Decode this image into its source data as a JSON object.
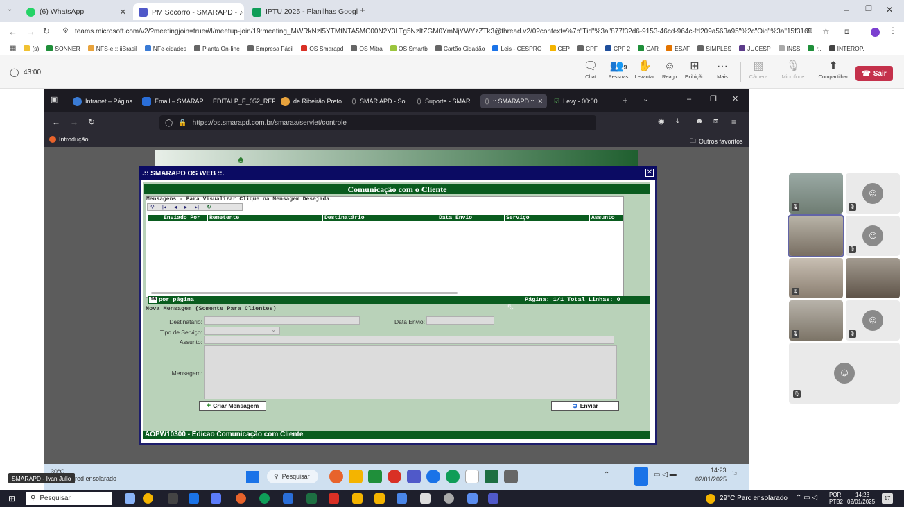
{
  "outer_tabs": [
    {
      "label": "(6) WhatsApp",
      "color": "#25d366"
    },
    {
      "label": "PM Socorro - SMARAPD - ♪ 🔊",
      "color": "#5059c9"
    },
    {
      "label": "IPTU 2025 - Planilhas Google",
      "color": "#0f9d58"
    }
  ],
  "url": "teams.microsoft.com/v2/?meetingjoin=true#/l/meetup-join/19:meeting_MWRkNzI5YTMtNTA5MC00N2Y3LTg5NzItZGM0YmNjYWYzZTk3@thread.v2/0?context=%7b\"Tid\"%3a\"877f32d6-9153-46cd-964c-fd209a563a95\"%2c\"Oid\"%3a\"15f3165b-31b3-4...",
  "bookmarks": [
    "(s)",
    "SONNER",
    "NFS-e :: iiBrasil",
    "NFe-cidades",
    "Planta On-line",
    "Empresa Fácil",
    "OS Smarapd",
    "OS Mitra",
    "OS Smartb",
    "Cartão Cidadão",
    "Leis - CESPRO",
    "CEP",
    "CPF",
    "CPF 2",
    "CAR",
    "ESAF",
    "SIMPLES",
    "JUCESP",
    "INSS",
    "r..",
    "INTEROP."
  ],
  "teams": {
    "timer": "43:00",
    "buttons": [
      "Chat",
      "Pessoas",
      "Levantar",
      "Reagir",
      "Exibição",
      "Mais",
      "Câmera",
      "Microfone",
      "Compartilhar"
    ],
    "people_count": "9",
    "leave": "Sair"
  },
  "inner_tabs": [
    "Intranet – Página",
    "Email – SMARAP",
    "EDITALP_E_052_REPI",
    "de Ribeirão Preto",
    "SMAR APD - Sol",
    "Suporte - SMAR",
    ":: SMARAPD ::",
    "Levy - 00:00"
  ],
  "inner_url": "https://os.smarapd.com.br/smaraa/servlet/controle",
  "inner_bookmark": "Introdução",
  "inner_favorites": "Outros favoritos",
  "dialog": {
    "title": ".:: SMARAPD OS WEB ::.",
    "header": "Comunicação com o Cliente",
    "messages_caption": "Mensagens - Para Visualizar Clique na Mensagem Desejada.",
    "columns": [
      "Enviado Por",
      "Remetente",
      "Destinatário",
      "Data Envio",
      "Serviço",
      "Assunto"
    ],
    "per_page_value": "16",
    "per_page_label": "por página",
    "pager": "Página: 1/1 Total Linhas: 0",
    "new_caption": "Nova Mensagem (Somente Para Clientes)",
    "labels": {
      "destinatario": "Destinatário:",
      "data_envio": "Data Envio:",
      "tipo_servico": "Tipo de Serviço:",
      "assunto": "Assunto:",
      "mensagem": "Mensagem:"
    },
    "btn_criar": "Criar Mensagem",
    "btn_enviar": "Enviar",
    "footer": "AOPW10300 - Edicao Comunicação com Cliente"
  },
  "inner_taskbar": {
    "search": "Pesquisar",
    "time": "14:23",
    "date": "02/01/2025",
    "weather": "30°C",
    "weather_sub": "Pred ensolarado"
  },
  "presenter_label": "SMARAPD - Ivan Julio",
  "outer_taskbar": {
    "search": "Pesquisar",
    "weather": "29°C  Parc ensolarado",
    "lang": "POR",
    "lang2": "PTB2",
    "time": "14:23",
    "date": "02/01/2025",
    "badge": "17"
  }
}
